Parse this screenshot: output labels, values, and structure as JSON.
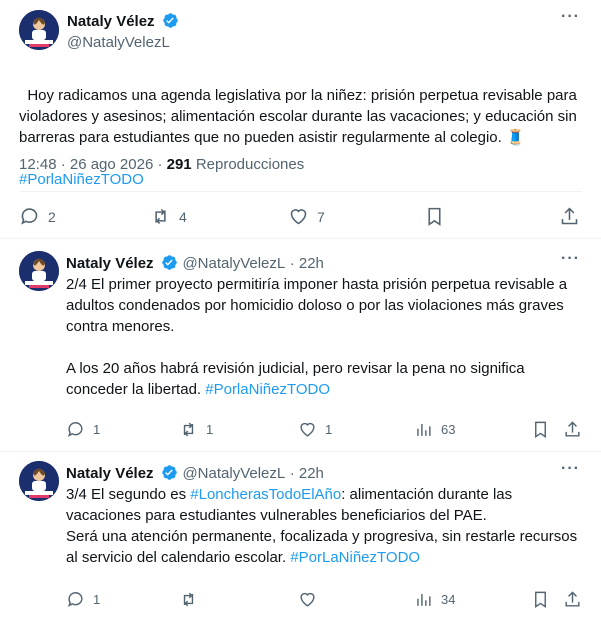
{
  "main_tweet": {
    "author_name": "Nataly Vélez",
    "author_handle": "@NatalyVelezL",
    "text_plain": "Hoy radicamos una agenda legislativa por la niñez: prisión perpetua revisable para violadores y asesinos; alimentación escolar durante las vacaciones; y educación sin barreras para estudiantes que no pueden asistir regularmente al colegio. 🧵",
    "hashtag": "#PorlaNiñezTODO",
    "time": "12:48 · 26 ago 2026 · ",
    "views_count": "291",
    "views_label": " Reproducciones",
    "replies": "2",
    "retweets": "4",
    "likes": "7"
  },
  "replies": [
    {
      "author_name": "Nataly Vélez",
      "author_handle": "@NatalyVelezL",
      "time": "· 22h",
      "text_1": "2/4 El primer proyecto permitiría imponer hasta prisión perpetua revisable a adultos condenados por homicidio doloso o por las violaciones más graves contra menores.\n\nA los 20 años habrá revisión judicial, pero revisar la pena no significa conceder la libertad. ",
      "hashtag": "#PorlaNiñezTODO",
      "replies": "1",
      "retweets": "1",
      "likes": "1",
      "views": "63"
    },
    {
      "author_name": "Nataly Vélez",
      "author_handle": "@NatalyVelezL",
      "time": "· 22h",
      "text_pre": "3/4 El segundo es ",
      "hashtag_inline": "#LoncherasTodoElAño",
      "text_post": ": alimentación durante las vacaciones para estudiantes vulnerables beneficiarios del PAE.\nSerá una atención permanente, focalizada y progresiva, sin restarle recursos al servicio del calendario escolar. ",
      "hashtag": "#PorLaNiñezTODO",
      "replies": "1",
      "retweets": "",
      "likes": "",
      "views": "34"
    }
  ],
  "colors": {
    "link": "#1d9bf0",
    "secondary_text": "#536471",
    "divider": "#eff3f4",
    "verified": "#1d9bf0"
  },
  "icons": [
    "verified-badge-icon",
    "more-icon",
    "reply-icon",
    "retweet-icon",
    "like-icon",
    "views-icon",
    "bookmark-icon",
    "share-icon"
  ]
}
